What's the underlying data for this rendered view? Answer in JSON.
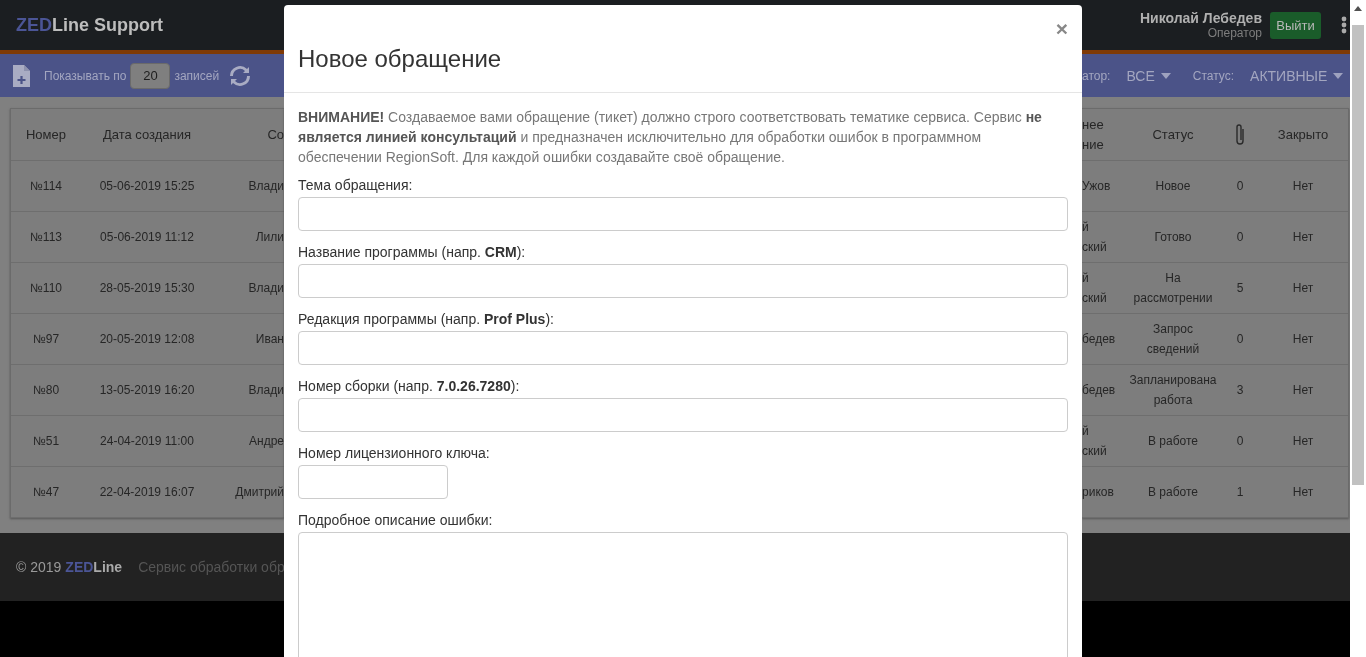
{
  "header": {
    "logo": {
      "accent": "ZED",
      "text": "Line Support"
    },
    "user_name": "Николай Лебедев",
    "user_role": "Оператор",
    "logout_button": "Выйти"
  },
  "toolbar": {
    "page_size_label": "Показывать по",
    "page_size": "20",
    "page_size_suffix": "записей",
    "operator_label": "атор:",
    "operator_value": "ВСЕ",
    "status_label": "Статус:",
    "status_value": "АКТИВНЫЕ"
  },
  "table": {
    "columns": [
      {
        "kind": "text",
        "label": "Номер"
      },
      {
        "kind": "text",
        "label": "Дата создания"
      },
      {
        "kind": "text",
        "label": "Со"
      },
      {
        "kind": "text",
        "label": "нее\nние"
      },
      {
        "kind": "text",
        "label": "Статус"
      },
      {
        "kind": "attachments"
      },
      {
        "kind": "text",
        "label": "Закрыто"
      }
    ],
    "rows": [
      {
        "number": "№114",
        "created": "05-06-2019 15:25",
        "column_3": "Влади",
        "column_4": "Ужов",
        "status": "Новое",
        "attachments": "0",
        "closed": "Нет"
      },
      {
        "number": "№113",
        "created": "05-06-2019 11:12",
        "column_3": "Лили",
        "column_4": "й\nский",
        "status": "Готово",
        "attachments": "0",
        "closed": "Нет"
      },
      {
        "number": "№110",
        "created": "28-05-2019 15:30",
        "column_3": "Влади",
        "column_4": "й\nский",
        "status": "На рассмотрении",
        "attachments": "5",
        "closed": "Нет"
      },
      {
        "number": "№97",
        "created": "20-05-2019 12:08",
        "column_3": "Иван",
        "column_4": "бедев",
        "status": "Запрос сведений",
        "attachments": "0",
        "closed": "Нет"
      },
      {
        "number": "№80",
        "created": "13-05-2019 16:20",
        "column_3": "Влади",
        "column_4": "бедев",
        "status": "Запланирована работа",
        "attachments": "3",
        "closed": "Нет"
      },
      {
        "number": "№51",
        "created": "24-04-2019 11:00",
        "column_3": "Андре",
        "column_4": "й\nский",
        "status": "В работе",
        "attachments": "0",
        "closed": "Нет"
      },
      {
        "number": "№47",
        "created": "22-04-2019 16:07",
        "column_3": "Дмитрий",
        "column_4": "риков",
        "status": "В работе",
        "attachments": "1",
        "closed": "Нет"
      }
    ]
  },
  "footer": {
    "copyright": "© 2019",
    "brand": {
      "accent": "ZED",
      "text": "Line"
    },
    "tagline": "Сервис обработки обр"
  },
  "modal": {
    "title": "Новое обращение",
    "close": "×",
    "notice": "**ВНИМАНИЕ!** Создаваемое вами обращение (тикет) должно строго соответствовать тематике сервиса. Сервис **не является линией консультаций** и предназначен исключительно для обработки ошибок в программном обеспечении RegionSoft. Для каждой ошибки создавайте своё обращение.",
    "fields": [
      {
        "kind": "text",
        "label": "Тема обращения:"
      },
      {
        "kind": "text",
        "label": "Название программы (напр. **CRM**):"
      },
      {
        "kind": "text",
        "label": "Редакция программы (напр. **Prof Plus**):"
      },
      {
        "kind": "text",
        "label": "Номер сборки (напр. **7.0.26.7280**):"
      },
      {
        "kind": "short",
        "label": "Номер лицензионного ключа:"
      },
      {
        "kind": "textarea",
        "label": "Подробное описание ошибки:"
      }
    ]
  }
}
